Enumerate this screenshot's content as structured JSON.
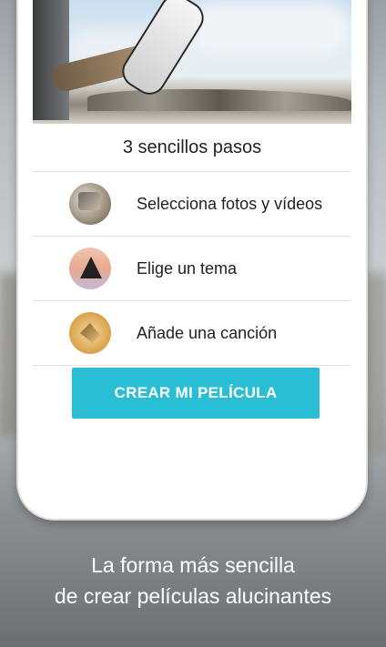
{
  "card": {
    "title": "3 sencillos pasos",
    "steps": [
      {
        "label": "Selecciona fotos y vídeos",
        "icon": "photos-thumbnail"
      },
      {
        "label": "Elige un tema",
        "icon": "theme-thumbnail"
      },
      {
        "label": "Añade una canción",
        "icon": "song-thumbnail"
      }
    ],
    "cta_label": "CREAR MI PELÍCULA"
  },
  "tagline": {
    "line1": "La forma más sencilla",
    "line2": "de crear películas alucinantes"
  },
  "colors": {
    "accent": "#29bed3",
    "text": "#1f1f1f",
    "tagline": "#ffffff"
  }
}
